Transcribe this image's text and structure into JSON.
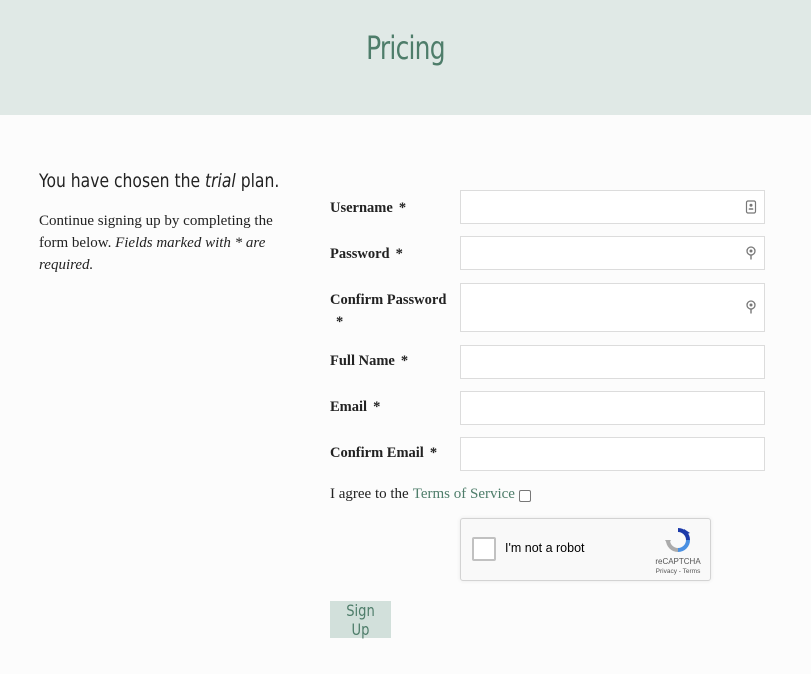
{
  "header": {
    "title": "Pricing"
  },
  "intro": {
    "plan_prefix": "You have chosen the ",
    "plan_name": "trial",
    "plan_suffix": " plan.",
    "desc_text": "Continue signing up by completing the form below. ",
    "desc_note": "Fields marked with * are required."
  },
  "form": {
    "required_mark": "*",
    "fields": {
      "username": {
        "label": "Username",
        "value": ""
      },
      "password": {
        "label": "Password",
        "value": ""
      },
      "confirm_password": {
        "label": "Confirm Password",
        "value": ""
      },
      "full_name": {
        "label": "Full Name",
        "value": ""
      },
      "email": {
        "label": "Email",
        "value": ""
      },
      "confirm_email": {
        "label": "Confirm Email",
        "value": ""
      }
    },
    "agree_prefix": "I agree to the",
    "terms_link": "Terms of Service",
    "recaptcha": {
      "label": "I'm not a robot",
      "brand": "reCAPTCHA",
      "privacy": "Privacy",
      "terms": "Terms"
    },
    "submit_label": "Sign Up"
  },
  "colors": {
    "header_bg": "#e0e9e6",
    "accent": "#4e7d6a",
    "button_bg": "#d2e0db"
  }
}
